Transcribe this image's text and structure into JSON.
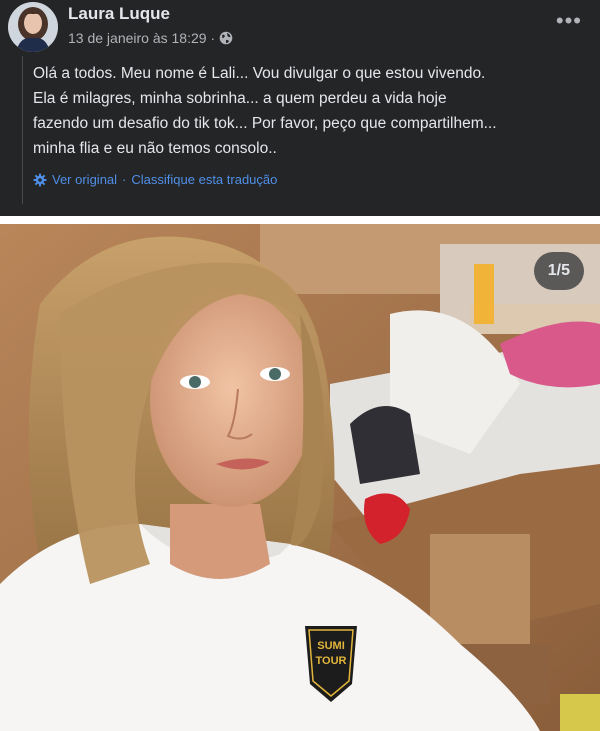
{
  "post": {
    "author": "Laura Luque",
    "timestamp": "13 de janeiro às 18:29 ·",
    "privacy_icon": "globe-icon",
    "more_label": "•••",
    "message_lines": [
      "Olá a todos. Meu nome é Lali... Vou divulgar o que estou vivendo.",
      "Ela é milagres, minha sobrinha... a quem perdeu a vida hoje",
      "fazendo um desafio do tik tok... Por favor, peço que compartilhem...",
      "minha flia e eu não temos consolo.."
    ],
    "view_original": "Ver original",
    "separator": "·",
    "rate_translation": "Classifique esta tradução"
  },
  "photo": {
    "counter": "1/5",
    "shirt_badge_text": [
      "SUMI",
      "TOUR"
    ]
  },
  "colors": {
    "post_background": "#242526",
    "text_primary": "#e4e6eb",
    "text_secondary": "#b0b3b8",
    "link": "#4f8fe8"
  }
}
